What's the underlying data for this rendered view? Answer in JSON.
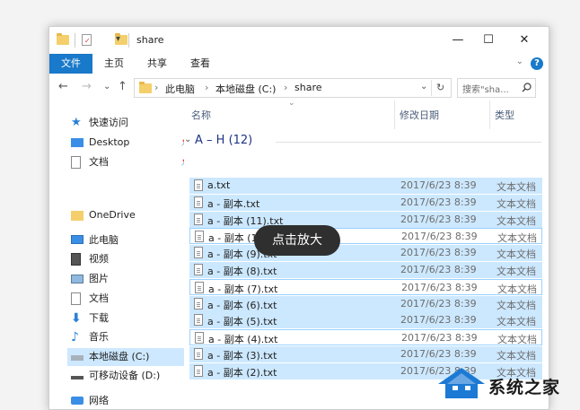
{
  "window": {
    "title": "share",
    "minimize": "—",
    "maximize": "☐",
    "close": "✕"
  },
  "quick_access_toolbar": {
    "customize": "▾"
  },
  "ribbon": {
    "tabs": [
      "文件",
      "主页",
      "共享",
      "查看"
    ],
    "collapse": "⌄",
    "help": "?"
  },
  "nav": {
    "back": "←",
    "forward": "→",
    "recent": "⌄",
    "up": "↑",
    "breadcrumb": [
      "此电脑",
      "本地磁盘 (C:)",
      "share"
    ],
    "separator": "›",
    "dropdown": "⌄",
    "refresh": "↻",
    "search_placeholder": "搜索\"sha...",
    "search_icon": "magnifier-icon"
  },
  "sidebar": {
    "items": [
      {
        "label": "快速访问",
        "icon": "star-icon"
      },
      {
        "label": "Desktop",
        "icon": "desktop-icon",
        "pinned": true
      },
      {
        "label": "文档",
        "icon": "documents-icon",
        "pinned": true
      },
      {
        "label": "OneDrive",
        "icon": "folder-icon"
      },
      {
        "label": "此电脑",
        "icon": "computer-icon"
      },
      {
        "label": "视频",
        "icon": "video-icon"
      },
      {
        "label": "图片",
        "icon": "pictures-icon"
      },
      {
        "label": "文档",
        "icon": "documents-icon"
      },
      {
        "label": "下载",
        "icon": "download-icon"
      },
      {
        "label": "音乐",
        "icon": "music-icon"
      },
      {
        "label": "本地磁盘 (C:)",
        "icon": "drive-icon",
        "selected": true
      },
      {
        "label": "可移动设备 (D:)",
        "icon": "usb-drive-icon"
      },
      {
        "label": "网络",
        "icon": "network-icon"
      }
    ]
  },
  "columns": {
    "name": "名称",
    "modified": "修改日期",
    "type": "类型"
  },
  "group": {
    "label": "A – H (12)"
  },
  "files": [
    {
      "name": "a.txt",
      "date": "2017/6/23 8:39",
      "type": "文本文档",
      "selected": true
    },
    {
      "name": "a - 副本.txt",
      "date": "2017/6/23 8:39",
      "type": "文本文档",
      "selected": true
    },
    {
      "name": "a - 副本 (11).txt",
      "date": "2017/6/23 8:39",
      "type": "文本文档",
      "selected": true
    },
    {
      "name": "a - 副本 (10).txt",
      "date": "2017/6/23 8:39",
      "type": "文本文档",
      "selected": false
    },
    {
      "name": "a - 副本 (9).txt",
      "date": "2017/6/23 8:39",
      "type": "文本文档",
      "selected": true
    },
    {
      "name": "a - 副本 (8).txt",
      "date": "2017/6/23 8:39",
      "type": "文本文档",
      "selected": true
    },
    {
      "name": "a - 副本 (7).txt",
      "date": "2017/6/23 8:39",
      "type": "文本文档",
      "selected": false
    },
    {
      "name": "a - 副本 (6).txt",
      "date": "2017/6/23 8:39",
      "type": "文本文档",
      "selected": true
    },
    {
      "name": "a - 副本 (5).txt",
      "date": "2017/6/23 8:39",
      "type": "文本文档",
      "selected": true
    },
    {
      "name": "a - 副本 (4).txt",
      "date": "2017/6/23 8:39",
      "type": "文本文档",
      "selected": false
    },
    {
      "name": "a - 副本 (3).txt",
      "date": "2017/6/23 8:39",
      "type": "文本文档",
      "selected": true
    },
    {
      "name": "a - 副本 (2).txt",
      "date": "2017/6/23 8:39",
      "type": "文本文档",
      "selected": true
    }
  ],
  "overlay": {
    "zoom_label": "点击放大"
  },
  "watermark": {
    "text": "系统之家"
  },
  "colors": {
    "accent": "#1979ca",
    "selection": "#cce8ff",
    "group_label": "#1e3287"
  }
}
